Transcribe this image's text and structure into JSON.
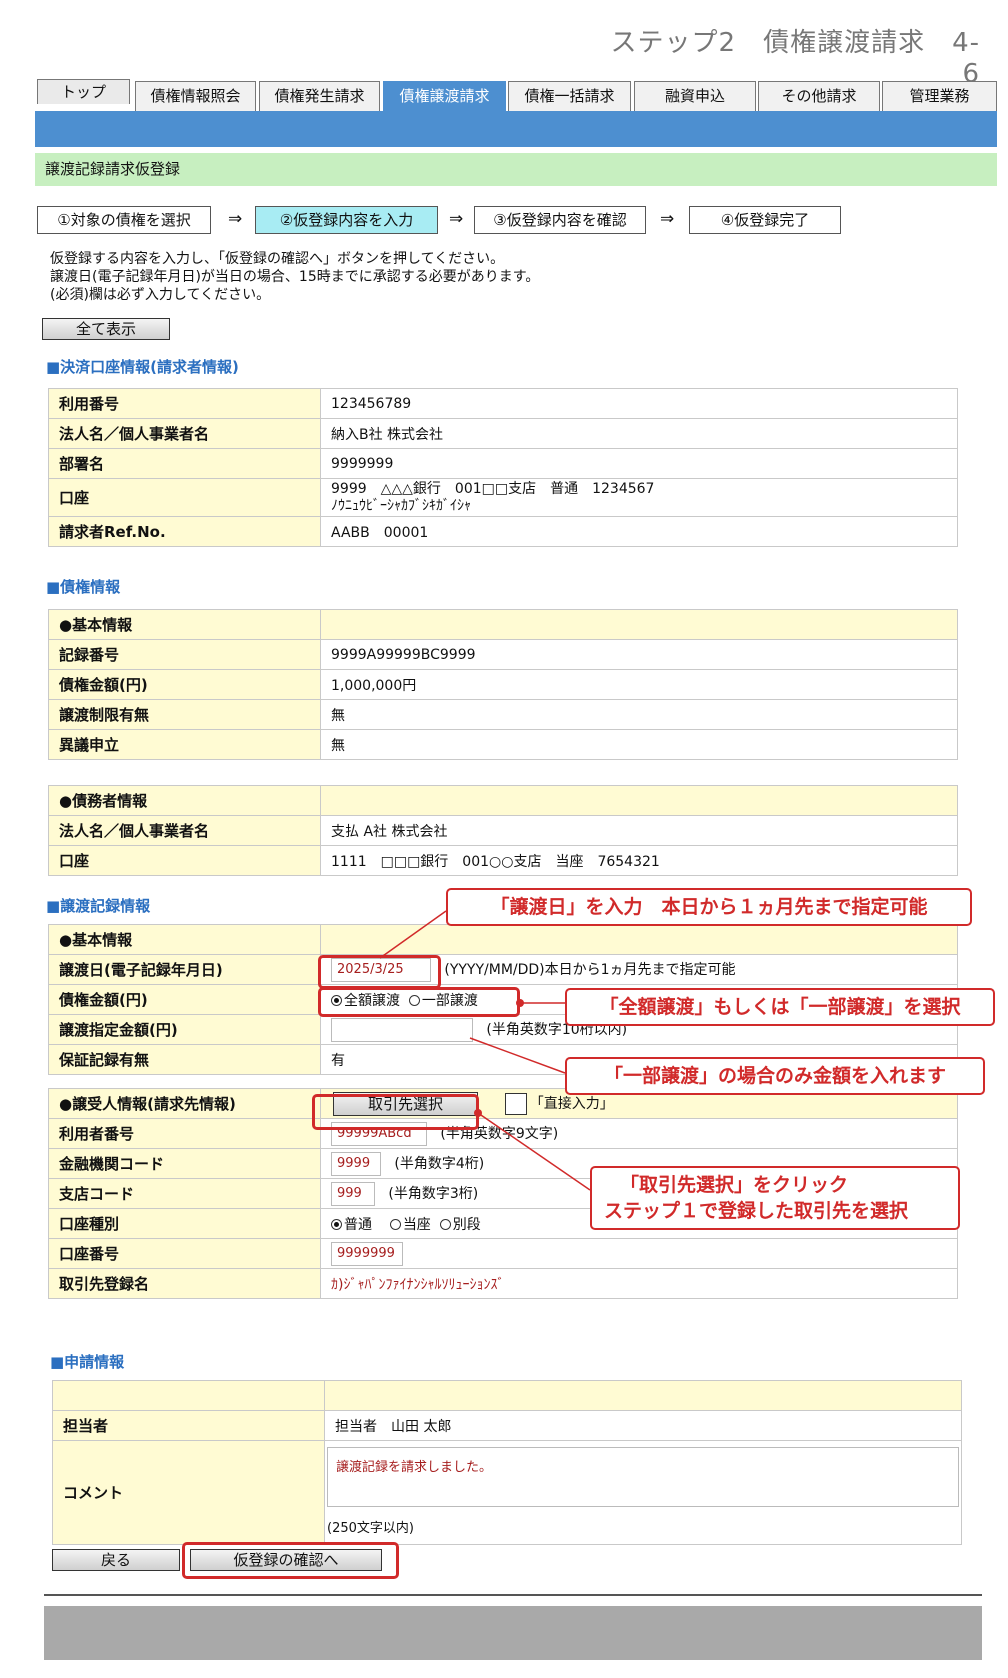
{
  "header": {
    "step_title": "ステップ2　債権譲渡請求　4-6"
  },
  "tabs": [
    "トップ",
    "債権情報照会",
    "債権発生請求",
    "債権譲渡請求",
    "債権一括請求",
    "融資申込",
    "その他請求",
    "管理業務"
  ],
  "page_title": "譲渡記録請求仮登録",
  "steps": [
    "①対象の債権を選択",
    "②仮登録内容を入力",
    "③仮登録内容を確認",
    "④仮登録完了"
  ],
  "arrow": "⇒",
  "instructions": [
    "仮登録する内容を入力し、「仮登録の確認へ」ボタンを押してください。",
    "譲渡日(電子記録年月日)が当日の場合、15時までに承認する必要があります。",
    "(必須)欄は必ず入力してください。"
  ],
  "show_all_button": "全て表示",
  "settlement": {
    "title": "■決済口座情報(請求者情報)",
    "rows": [
      [
        "利用番号",
        "123456789"
      ],
      [
        "法人名／個人事業者名",
        "納入B社 株式会社"
      ],
      [
        "部署名",
        "9999999"
      ],
      [
        "口座",
        "9999　△△△銀行　001□□支店　普通　1234567"
      ],
      [
        "請求者Ref.No.",
        "AABB　00001"
      ]
    ],
    "account_kana": "ﾉｳﾆｭｳﾋﾞｰｼｬｶﾌﾞｼｷｶﾞｲｼｬ"
  },
  "bond": {
    "title": "■債権情報",
    "basic_header": "●基本情報",
    "rows": [
      [
        "記録番号",
        "9999A99999BC9999"
      ],
      [
        "債権金額(円)",
        "1,000,000円"
      ],
      [
        "譲渡制限有無",
        "無"
      ],
      [
        "異議申立",
        "無"
      ]
    ],
    "debtor_header": "●債務者情報",
    "debtor_rows": [
      [
        "法人名／個人事業者名",
        "支払 A社 株式会社"
      ],
      [
        "口座",
        "1111　□□□銀行　001○○支店　当座　7654321"
      ]
    ]
  },
  "transfer": {
    "title": "■譲渡記録情報",
    "basic_header": "●基本情報",
    "date_label": "譲渡日(電子記録年月日)",
    "date_value": "2025/3/25",
    "date_hint": "(YYYY/MM/DD)本日から1ヵ月先まで指定可能",
    "amount_label": "債権金額(円)",
    "radio_full": "全額譲渡",
    "radio_partial": "一部譲渡",
    "specified_label": "譲渡指定金額(円)",
    "specified_hint": "(半角英数字10桁以内)",
    "guarantee_label": "保証記録有無",
    "guarantee_value": "有",
    "recipient_header": "●譲受人情報(請求先情報)",
    "partner_button": "取引先選択",
    "direct_input": "「直接入力」",
    "user_no_label": "利用者番号",
    "user_no_value": "99999ABcd",
    "user_no_hint": "(半角英数字9文字)",
    "bank_code_label": "金融機関コード",
    "bank_code_value": "9999",
    "bank_code_hint": "(半角数字4桁)",
    "branch_code_label": "支店コード",
    "branch_code_value": "999",
    "branch_code_hint": "(半角数字3桁)",
    "account_type_label": "口座種別",
    "account_types": [
      "普通",
      "当座",
      "別段"
    ],
    "account_no_label": "口座番号",
    "account_no_value": "9999999",
    "partner_name_label": "取引先登録名",
    "partner_name_value": "ｶ)ｼﾞｬﾊﾟﾝﾌｧｲﾅﾝｼｬﾙｿﾘｭｰｼｮﾝｽﾞ"
  },
  "application": {
    "title": "■申請情報",
    "person_label": "担当者",
    "person_value": "担当者　山田 太郎",
    "comment_label": "コメント",
    "comment_value": "譲渡記録を請求しました。",
    "comment_hint": "(250文字以内)"
  },
  "buttons": {
    "back": "戻る",
    "confirm": "仮登録の確認へ"
  },
  "annotations": {
    "date": "「譲渡日」を入力　本日から１ヵ月先まで指定可能",
    "radio": "「全額譲渡」もしくは「一部譲渡」を選択",
    "amount": "「一部譲渡」の場合のみ金額を入れます",
    "partner_1": "「取引先選択」をクリック",
    "partner_2": "ステップ１で登録した取引先を選択"
  },
  "colors": {
    "nav_blue": "#4d8fd0",
    "title_green": "#c7efc0",
    "label_yellow": "#fffbd3",
    "annotation_red": "#d12a2a",
    "input_red": "#a61e1e"
  }
}
